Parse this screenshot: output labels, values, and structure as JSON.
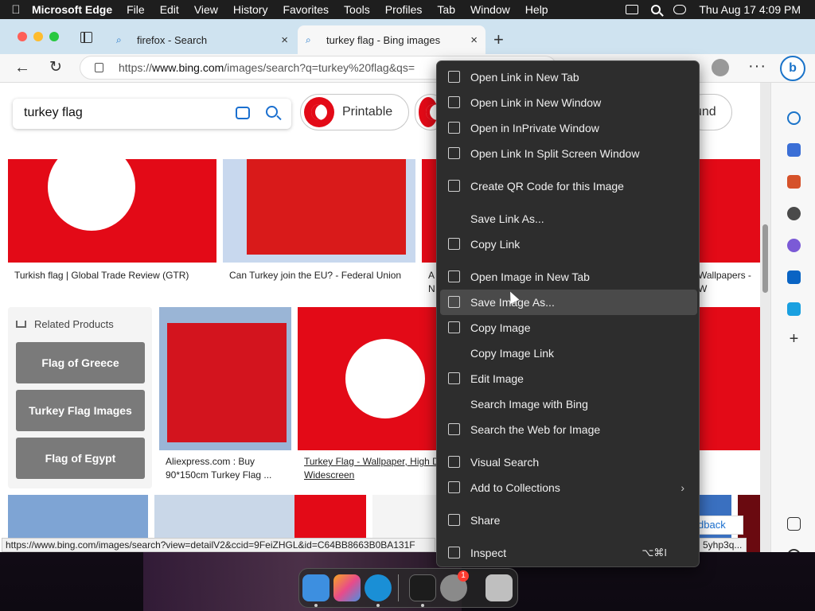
{
  "menubar": {
    "app_name": "Microsoft Edge",
    "items": [
      "File",
      "Edit",
      "View",
      "History",
      "Favorites",
      "Tools",
      "Profiles",
      "Tab",
      "Window",
      "Help"
    ],
    "clock": "Thu Aug 17  4:09 PM"
  },
  "tabs": [
    {
      "label": "firefox - Search",
      "close": "×"
    },
    {
      "label": "turkey flag - Bing images",
      "close": "×"
    }
  ],
  "newtab": "+",
  "address": {
    "prefix": "https://",
    "host": "www.bing.com",
    "path": "/images/search?q=turkey%20flag&qs="
  },
  "toolbar": {
    "more": "···",
    "copilot": "b"
  },
  "search": {
    "query": "turkey flag"
  },
  "chips": [
    {
      "label": "Printable"
    },
    {
      "label": "und"
    }
  ],
  "results": {
    "captions": [
      "Turkish flag | Global Trade Review (GTR)",
      "Can Turkey join the EU? - Federal Union",
      "A",
      "N",
      "Wallpapers - W",
      "Aliexpress.com : Buy 90*150cm Turkey Flag ...",
      "Turkey Flag - Wallpaper, High De",
      "Widescreen"
    ]
  },
  "related": {
    "title": "Related Products",
    "items": [
      "Flag of Greece",
      "Turkey Flag Images",
      "Flag of Egypt"
    ]
  },
  "feedback": "dback",
  "status": {
    "url": "https://www.bing.com/images/search?view=detailV2&ccid=9FeiZHGL&id=C64BB8663B0BA131F",
    "url_tail": "5yhp3q..."
  },
  "context_menu": {
    "items": [
      {
        "label": "Open Link in New Tab",
        "icon": "new-tab-icon"
      },
      {
        "label": "Open Link in New Window",
        "icon": "new-window-icon"
      },
      {
        "label": "Open in InPrivate Window",
        "icon": "inprivate-icon"
      },
      {
        "label": "Open Link In Split Screen Window",
        "icon": "split-screen-icon"
      },
      {
        "label": "Create QR Code for this Image",
        "icon": "qr-code-icon"
      },
      {
        "label": "Save Link As...",
        "icon": ""
      },
      {
        "label": "Copy Link",
        "icon": "link-icon"
      },
      {
        "label": "Open Image in New Tab",
        "icon": "image-tab-icon"
      },
      {
        "label": "Save Image As...",
        "icon": "save-image-icon"
      },
      {
        "label": "Copy Image",
        "icon": "copy-image-icon"
      },
      {
        "label": "Copy Image Link",
        "icon": ""
      },
      {
        "label": "Edit Image",
        "icon": "edit-image-icon"
      },
      {
        "label": "Search Image with Bing",
        "icon": ""
      },
      {
        "label": "Search the Web for Image",
        "icon": "search-web-icon"
      },
      {
        "label": "Visual Search",
        "icon": "visual-search-icon"
      },
      {
        "label": "Add to Collections",
        "icon": "collections-icon",
        "chevron": "›"
      },
      {
        "label": "Share",
        "icon": "share-icon"
      },
      {
        "label": "Inspect",
        "icon": "inspect-icon",
        "shortcut": "⌥⌘I"
      }
    ],
    "hovered_index": 8
  },
  "dock": {
    "badge": "1"
  },
  "colors": {
    "accent": "#1a73c9",
    "flag_red": "#e30a17",
    "menu_bg": "#2d2d2d",
    "hover": "#4a4a4a"
  }
}
